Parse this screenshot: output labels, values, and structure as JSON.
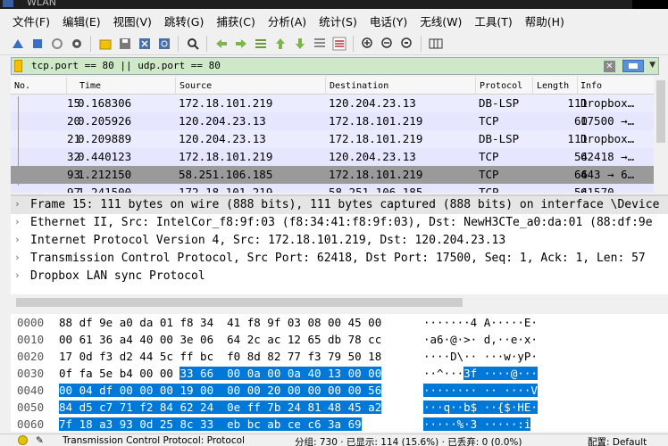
{
  "window": {
    "title": "WLAN"
  },
  "menubar": [
    "文件(F)",
    "编辑(E)",
    "视图(V)",
    "跳转(G)",
    "捕获(C)",
    "分析(A)",
    "统计(S)",
    "电话(Y)",
    "无线(W)",
    "工具(T)",
    "帮助(H)"
  ],
  "toolbar_icons": [
    "shark-fin-start-icon",
    "stop-icon",
    "restart-icon",
    "capture-options-icon",
    "open-file-icon",
    "save-icon",
    "close-file-icon",
    "reload-icon",
    "find-icon",
    "go-back-icon",
    "go-forward-icon",
    "go-to-packet-icon",
    "go-first-icon",
    "go-last-icon",
    "autoscroll-icon",
    "colorize-icon",
    "zoom-in-icon",
    "zoom-out-icon",
    "zoom-normal-icon",
    "resize-columns-icon"
  ],
  "filter": {
    "text": "tcp.port == 80 || udp.port == 80"
  },
  "packet_list": {
    "columns": [
      "No.",
      "Time",
      "Source",
      "Destination",
      "Protocol",
      "Length",
      "Info"
    ],
    "rows": [
      {
        "no": "15",
        "time": "0.168306",
        "src": "172.18.101.219",
        "dst": "120.204.23.13",
        "proto": "DB-LSP",
        "len": "111",
        "info": "Dropbox…",
        "style": "dblsp"
      },
      {
        "no": "20",
        "time": "0.205926",
        "src": "120.204.23.13",
        "dst": "172.18.101.219",
        "proto": "TCP",
        "len": "60",
        "info": "17500 →…",
        "style": "tcp"
      },
      {
        "no": "21",
        "time": "0.209889",
        "src": "120.204.23.13",
        "dst": "172.18.101.219",
        "proto": "DB-LSP",
        "len": "111",
        "info": "Dropbox…",
        "style": "dblsp"
      },
      {
        "no": "32",
        "time": "0.440123",
        "src": "172.18.101.219",
        "dst": "120.204.23.13",
        "proto": "TCP",
        "len": "54",
        "info": "62418 →…",
        "style": "tcp"
      },
      {
        "no": "93",
        "time": "1.212150",
        "src": "58.251.106.185",
        "dst": "172.18.101.219",
        "proto": "TCP",
        "len": "66",
        "info": "443 → 6…",
        "style": "sel"
      },
      {
        "no": "97",
        "time": "1.241500",
        "src": "172.18.101.219",
        "dst": "58.251.106.185",
        "proto": "TCP",
        "len": "54",
        "info": "61570 …",
        "style": "tcp"
      }
    ]
  },
  "details": [
    {
      "arrow": "›",
      "text": "Frame 15: 111 bytes on wire (888 bits), 111 bytes captured (888 bits) on interface \\Device",
      "sel": true
    },
    {
      "arrow": "›",
      "text": "Ethernet II, Src: IntelCor_f8:9f:03 (f8:34:41:f8:9f:03), Dst: NewH3CTe_a0:da:01 (88:df:9e"
    },
    {
      "arrow": "›",
      "text": "Internet Protocol Version 4, Src: 172.18.101.219, Dst: 120.204.23.13"
    },
    {
      "arrow": "›",
      "text": "Transmission Control Protocol, Src Port: 62418, Dst Port: 17500, Seq: 1, Ack: 1, Len: 57"
    },
    {
      "arrow": "›",
      "text": "Dropbox LAN sync Protocol"
    }
  ],
  "bytes": [
    {
      "off": "0000",
      "hex_pre": "88 df 9e a0 da 01 f8 34  41 f8 9f 03 08 00 45 00",
      "hex_hl": "",
      "asc_pre": "·······4 A·····E·",
      "asc_hl": ""
    },
    {
      "off": "0010",
      "hex_pre": "00 61 36 a4 40 00 3e 06  64 2c ac 12 65 db 78 cc",
      "hex_hl": "",
      "asc_pre": "·a6·@·>· d,··e·x·",
      "asc_hl": ""
    },
    {
      "off": "0020",
      "hex_pre": "17 0d f3 d2 44 5c ff bc  f0 8d 82 77 f3 79 50 18",
      "hex_hl": "",
      "asc_pre": "····D\\·· ···w·yP·",
      "asc_hl": ""
    },
    {
      "off": "0030",
      "hex_pre": "0f fa 5e b4 00 00 ",
      "hex_hl": "33 66  00 0a 00 0a 40 13 00 00",
      "asc_pre": "··^···",
      "asc_hl": "3f ····@···"
    },
    {
      "off": "0040",
      "hex_pre": "",
      "hex_hl": "00 04 df 00 00 00 19 00  00 00 20 00 00 00 00 56",
      "asc_pre": "",
      "asc_hl": "········ ·· ····V"
    },
    {
      "off": "0050",
      "hex_pre": "",
      "hex_hl": "84 d5 c7 71 f2 84 62 24  0e ff 7b 24 81 48 45 a2",
      "asc_pre": "",
      "asc_hl": "···q··b$ ··{$·HE·"
    },
    {
      "off": "0060",
      "hex_pre": "",
      "hex_hl": "7f 18 a3 93 0d 25 8c 33  eb bc ab ce c6 3a 69",
      "asc_pre": "",
      "asc_hl": "·····%·3 ·····:i"
    }
  ],
  "statusbar": {
    "field": "Transmission Control Protocol: Protocol",
    "groups": "分组: 730 · 已显示: 114 (15.6%) · 已丢弃: 0 (0.0%)",
    "profile": "配置: Default"
  }
}
